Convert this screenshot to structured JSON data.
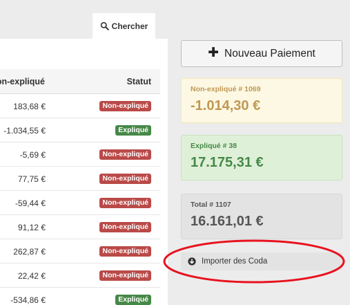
{
  "search_tab": {
    "label": "Chercher",
    "icon": "search-icon"
  },
  "table": {
    "headers": {
      "amount": "Non-expliqué",
      "status": "Statut"
    },
    "rows": [
      {
        "amount": "183,68 €",
        "status": "Non-expliqué",
        "status_color": "#b94a48"
      },
      {
        "amount": "-1.034,55 €",
        "status": "Expliqué",
        "status_color": "#468847"
      },
      {
        "amount": "-5,69 €",
        "status": "Non-expliqué",
        "status_color": "#b94a48"
      },
      {
        "amount": "77,75 €",
        "status": "Non-expliqué",
        "status_color": "#b94a48"
      },
      {
        "amount": "-59,44 €",
        "status": "Non-expliqué",
        "status_color": "#b94a48"
      },
      {
        "amount": "91,12 €",
        "status": "Non-expliqué",
        "status_color": "#b94a48"
      },
      {
        "amount": "262,87 €",
        "status": "Non-expliqué",
        "status_color": "#b94a48"
      },
      {
        "amount": "22,42 €",
        "status": "Non-expliqué",
        "status_color": "#b94a48"
      },
      {
        "amount": "-534,86 €",
        "status": "Expliqué",
        "status_color": "#468847"
      }
    ]
  },
  "new_payment": {
    "label": "Nouveau Paiement",
    "icon": "plus-icon"
  },
  "summary": {
    "unexplained": {
      "label": "Non-expliqué # 1069",
      "value": "-1.014,30 €"
    },
    "explained": {
      "label": "Expliqué # 38",
      "value": "17.175,31 €"
    },
    "total": {
      "label": "Total # 1107",
      "value": "16.161,01 €"
    }
  },
  "import_button": {
    "label": "Importer des Coda",
    "icon": "circle-arrow-down-icon"
  },
  "colors": {
    "danger": "#b94a48",
    "success": "#468847",
    "warning": "#c09853",
    "highlight": "#e8121e"
  }
}
